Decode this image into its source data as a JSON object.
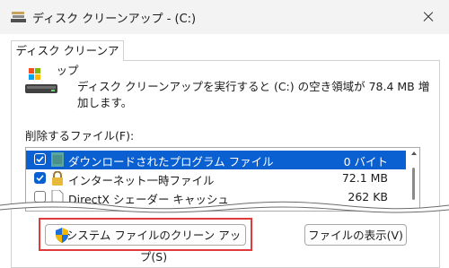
{
  "window": {
    "title": "ディスク クリーンアップ - (C:)",
    "icon": "disk-cleanup-icon"
  },
  "tabs": [
    {
      "label": "ディスク クリーンアップ",
      "active": true
    }
  ],
  "description": "ディスク クリーンアップを実行すると (C:) の空き領域が 78.4 MB 増加します。",
  "files_label": "削除するファイル(F):",
  "files": [
    {
      "name": "ダウンロードされたプログラム ファイル",
      "size": "0 バイト",
      "checked": true,
      "selected": true,
      "icon": "folder-icon"
    },
    {
      "name": "インターネット一時ファイル",
      "size": "72.1 MB",
      "checked": true,
      "selected": false,
      "icon": "lock-icon"
    },
    {
      "name": "DirectX シェーダー キャッシュ",
      "size": "262 KB",
      "checked": false,
      "selected": false,
      "icon": "file-icon"
    }
  ],
  "buttons": {
    "cleanup_system": "システム ファイルのクリーン アップ(S)",
    "view_files": "ファイルの表示(V)"
  },
  "colors": {
    "selection": "#0b60d1",
    "highlight": "#e03a3a"
  }
}
